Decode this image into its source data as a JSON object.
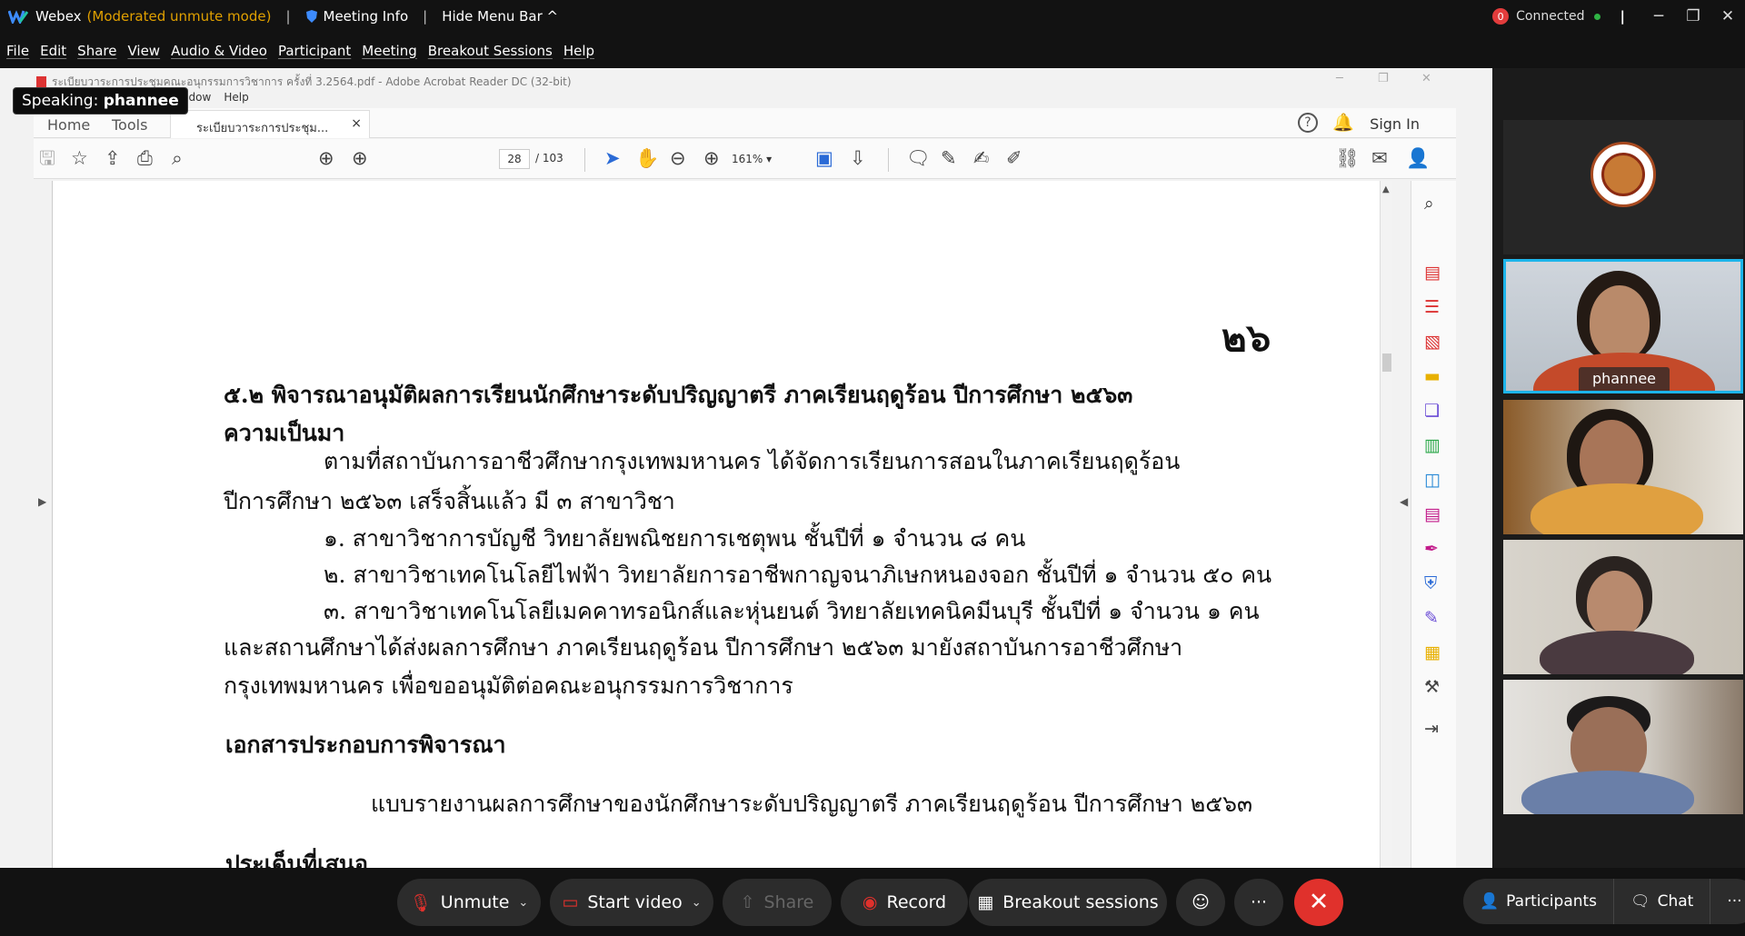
{
  "titlebar": {
    "app_name": "Webex",
    "app_status": "(Moderated unmute mode)",
    "meeting_info": "Meeting Info",
    "hide_menu_bar": "Hide Menu Bar ^",
    "connection_badge": "0",
    "connection_status": "Connected",
    "minimize": "─",
    "restore": "❐",
    "close": "✕"
  },
  "menubar": [
    "File",
    "Edit",
    "Share",
    "View",
    "Audio & Video",
    "Participant",
    "Meeting",
    "Breakout Sessions",
    "Help"
  ],
  "speaking": {
    "label": "Speaking:",
    "name": "phannee"
  },
  "acrobat": {
    "window_title": "ระเบียบวาระการประชุมคณะอนุกรรมการวิชาการ ครั้งที่ 3.2564.pdf - Adobe Acrobat Reader DC (32-bit)",
    "menu": [
      "Window",
      "Help"
    ],
    "tab_home": "Home",
    "tab_tools": "Tools",
    "doc_tab": "ระเบียบวาระการประชุม...",
    "doc_tab_close": "×",
    "sign_in": "Sign In",
    "help": "?",
    "page_current": "28",
    "page_total": "/ 103",
    "zoom": "161%"
  },
  "document": {
    "page_number": "๒๖",
    "heading": "๕.๒  พิจารณาอนุมัติผลการเรียนนักศึกษาระดับปริญญาตรี ภาคเรียนฤดูร้อน ปีการศึกษา ๒๕๖๓",
    "background_title": "ความเป็นมา",
    "para1_line1": "ตามที่สถาบันการอาชีวศึกษากรุงเทพมหานคร ได้จัดการเรียนการสอนในภาคเรียนฤดูร้อน",
    "para1_line2": "ปีการศึกษา ๒๕๖๓ เสร็จสิ้นแล้ว มี ๓ สาขาวิชา",
    "item1": "๑.  สาขาวิชาการบัญชี  วิทยาลัยพณิชยการเชตุพน  ชั้นปีที่ ๑  จำนวน  ๘  คน",
    "item2": "๒.  สาขาวิชาเทคโนโลยีไฟฟ้า  วิทยาลัยการอาชีพกาญจนาภิเษกหนองจอก  ชั้นปีที่ ๑  จำนวน ๕๐ คน",
    "item3": "๓.  สาขาวิชาเทคโนโลยีเมคคาทรอนิกส์และหุ่นยนต์ วิทยาลัยเทคนิคมีนบุรี ชั้นปีที่ ๑ จำนวน  ๑  คน",
    "para2_line1": "และสถานศึกษาได้ส่งผลการศึกษา ภาคเรียนฤดูร้อน  ปีการศึกษา ๒๕๖๓ มายังสถาบันการอาชีวศึกษา",
    "para2_line2": "กรุงเทพมหานคร เพื่อขออนุมัติต่อคณะอนุกรรมการวิชาการ",
    "attachments_title": "เอกสารประกอบการพิจารณา",
    "attachment1": "แบบรายงานผลการศึกษาของนักศึกษาระดับปริญญาตรี ภาคเรียนฤดูร้อน  ปีการศึกษา ๒๕๖๓",
    "issues_title": "ประเด็นที่เสนอ"
  },
  "participants": [
    {
      "name": "",
      "type": "logo"
    },
    {
      "name": "phannee",
      "type": "video",
      "active": true
    },
    {
      "name": "",
      "type": "video"
    },
    {
      "name": "",
      "type": "video"
    },
    {
      "name": "",
      "type": "video"
    }
  ],
  "controls": {
    "unmute": "Unmute",
    "start_video": "Start video",
    "share": "Share",
    "record": "Record",
    "breakout": "Breakout sessions",
    "reactions": "☺",
    "more": "···",
    "leave": "✕",
    "participants": "Participants",
    "chat": "Chat",
    "more_right": "···"
  },
  "colors": {
    "accent": "#1cb4ea",
    "leave": "#e0312c",
    "muted_status": "#e0a000",
    "connected": "#2fb344"
  }
}
